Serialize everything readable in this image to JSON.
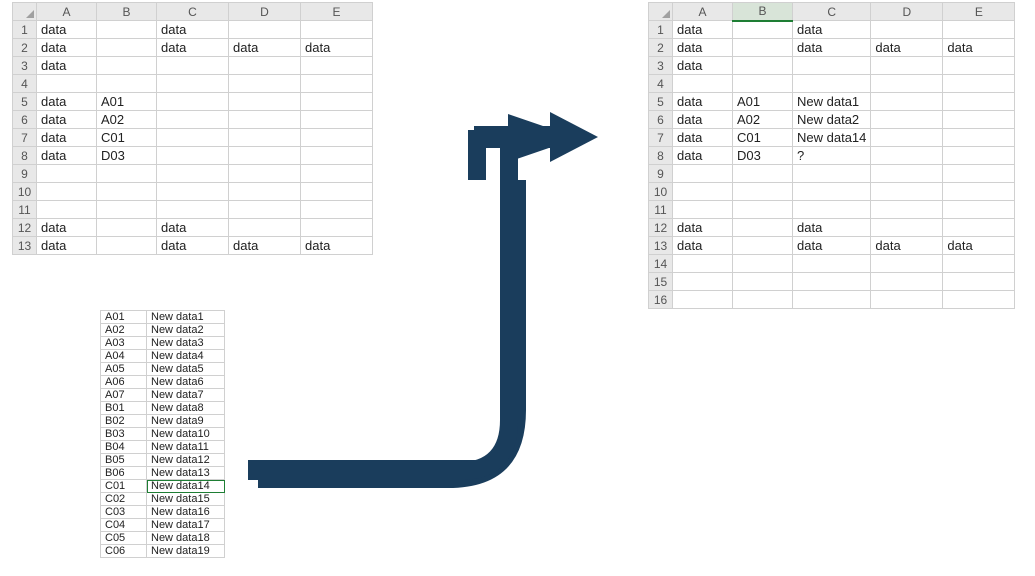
{
  "left_sheet": {
    "columns": [
      "A",
      "B",
      "C",
      "D",
      "E"
    ],
    "rows": [
      {
        "n": "1",
        "A": "data",
        "B": "",
        "C": "data",
        "D": "",
        "E": ""
      },
      {
        "n": "2",
        "A": "data",
        "B": "",
        "C": "data",
        "D": "data",
        "E": "data"
      },
      {
        "n": "3",
        "A": "data",
        "B": "",
        "C": "",
        "D": "",
        "E": ""
      },
      {
        "n": "4",
        "A": "",
        "B": "",
        "C": "",
        "D": "",
        "E": ""
      },
      {
        "n": "5",
        "A": "data",
        "B": "A01",
        "C": "",
        "D": "",
        "E": ""
      },
      {
        "n": "6",
        "A": "data",
        "B": "A02",
        "C": "",
        "D": "",
        "E": ""
      },
      {
        "n": "7",
        "A": "data",
        "B": "C01",
        "C": "",
        "D": "",
        "E": ""
      },
      {
        "n": "8",
        "A": "data",
        "B": "D03",
        "C": "",
        "D": "",
        "E": ""
      },
      {
        "n": "9",
        "A": "",
        "B": "",
        "C": "",
        "D": "",
        "E": ""
      },
      {
        "n": "10",
        "A": "",
        "B": "",
        "C": "",
        "D": "",
        "E": ""
      },
      {
        "n": "11",
        "A": "",
        "B": "",
        "C": "",
        "D": "",
        "E": ""
      },
      {
        "n": "12",
        "A": "data",
        "B": "",
        "C": "data",
        "D": "",
        "E": ""
      },
      {
        "n": "13",
        "A": "data",
        "B": "",
        "C": "data",
        "D": "data",
        "E": "data"
      }
    ]
  },
  "right_sheet": {
    "columns": [
      "A",
      "B",
      "C",
      "D",
      "E"
    ],
    "selected_column": "B",
    "rows": [
      {
        "n": "1",
        "A": "data",
        "B": "",
        "C": "data",
        "D": "",
        "E": ""
      },
      {
        "n": "2",
        "A": "data",
        "B": "",
        "C": "data",
        "D": "data",
        "E": "data"
      },
      {
        "n": "3",
        "A": "data",
        "B": "",
        "C": "",
        "D": "",
        "E": ""
      },
      {
        "n": "4",
        "A": "",
        "B": "",
        "C": "",
        "D": "",
        "E": ""
      },
      {
        "n": "5",
        "A": "data",
        "B": "A01",
        "C": "New data1",
        "D": "",
        "E": ""
      },
      {
        "n": "6",
        "A": "data",
        "B": "A02",
        "C": "New data2",
        "D": "",
        "E": ""
      },
      {
        "n": "7",
        "A": "data",
        "B": "C01",
        "C": "New data14",
        "D": "",
        "E": ""
      },
      {
        "n": "8",
        "A": "data",
        "B": "D03",
        "C": "?",
        "D": "",
        "E": ""
      },
      {
        "n": "9",
        "A": "",
        "B": "",
        "C": "",
        "D": "",
        "E": ""
      },
      {
        "n": "10",
        "A": "",
        "B": "",
        "C": "",
        "D": "",
        "E": ""
      },
      {
        "n": "11",
        "A": "",
        "B": "",
        "C": "",
        "D": "",
        "E": ""
      },
      {
        "n": "12",
        "A": "data",
        "B": "",
        "C": "data",
        "D": "",
        "E": ""
      },
      {
        "n": "13",
        "A": "data",
        "B": "",
        "C": "data",
        "D": "data",
        "E": "data"
      },
      {
        "n": "14",
        "A": "",
        "B": "",
        "C": "",
        "D": "",
        "E": ""
      },
      {
        "n": "15",
        "A": "",
        "B": "",
        "C": "",
        "D": "",
        "E": ""
      },
      {
        "n": "16",
        "A": "",
        "B": "",
        "C": "",
        "D": "",
        "E": ""
      }
    ]
  },
  "lookup_table": {
    "highlight_key": "C01",
    "rows": [
      {
        "key": "A01",
        "val": "New data1"
      },
      {
        "key": "A02",
        "val": "New data2"
      },
      {
        "key": "A03",
        "val": "New data3"
      },
      {
        "key": "A04",
        "val": "New data4"
      },
      {
        "key": "A05",
        "val": "New data5"
      },
      {
        "key": "A06",
        "val": "New data6"
      },
      {
        "key": "A07",
        "val": "New data7"
      },
      {
        "key": "B01",
        "val": "New data8"
      },
      {
        "key": "B02",
        "val": "New data9"
      },
      {
        "key": "B03",
        "val": "New data10"
      },
      {
        "key": "B04",
        "val": "New data11"
      },
      {
        "key": "B05",
        "val": "New data12"
      },
      {
        "key": "B06",
        "val": "New data13"
      },
      {
        "key": "C01",
        "val": "New data14"
      },
      {
        "key": "C02",
        "val": "New data15"
      },
      {
        "key": "C03",
        "val": "New data16"
      },
      {
        "key": "C04",
        "val": "New data17"
      },
      {
        "key": "C05",
        "val": "New data18"
      },
      {
        "key": "C06",
        "val": "New data19"
      }
    ]
  },
  "arrow_color": "#1a3d5c"
}
